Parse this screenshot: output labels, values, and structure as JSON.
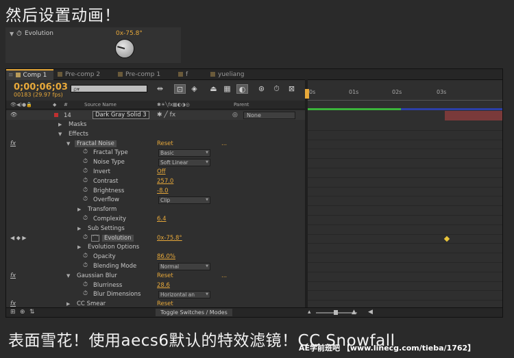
{
  "captions": {
    "top": "然后设置动画！",
    "bottom": "表面雪花！使用aecs6默认的特效滤镜！CC Snowfall",
    "watermark": "AE学前班吧 【www.linecg.com/tieba/1762】"
  },
  "evolution_preview": {
    "name": "Evolution",
    "value": "0x-75.8°"
  },
  "tabs": [
    {
      "label": "Comp 1",
      "active": true,
      "chip": "#b79a5a"
    },
    {
      "label": "Pre-comp 2",
      "active": false,
      "chip": "#6a5a3a"
    },
    {
      "label": "Pre-comp 1",
      "active": false,
      "chip": "#6a5a3a"
    },
    {
      "label": "f",
      "active": false,
      "chip": "#6a5a3a"
    },
    {
      "label": "yueliang",
      "active": false,
      "chip": "#6a5a3a"
    }
  ],
  "time": {
    "current": "0;00;06;03",
    "frames": "00183 (29.97 fps)"
  },
  "search": {
    "placeholder": "ρ▾"
  },
  "ruler": [
    "0s",
    "01s",
    "02s",
    "03s"
  ],
  "columns": {
    "num": "#",
    "source": "Source Name",
    "parent": "Parent"
  },
  "layer": {
    "index": "14",
    "name": "Dark Gray Solid 3",
    "parent": "None"
  },
  "properties": [
    {
      "indent": 1,
      "label": "Masks",
      "twirl": "▶"
    },
    {
      "indent": 1,
      "label": "Effects",
      "twirl": "▼"
    },
    {
      "indent": 2,
      "label": "Fractal Noise",
      "twirl": "▼",
      "fx": "fx",
      "reset": "Reset",
      "dots": "...",
      "highlight": true
    },
    {
      "indent": 3,
      "label": "Fractal Type",
      "stopwatch": true,
      "dropdown": "Basic"
    },
    {
      "indent": 3,
      "label": "Noise Type",
      "stopwatch": true,
      "dropdown": "Soft Linear"
    },
    {
      "indent": 3,
      "label": "Invert",
      "stopwatch": true,
      "value": "Off"
    },
    {
      "indent": 3,
      "label": "Contrast",
      "stopwatch": true,
      "value": "257.0"
    },
    {
      "indent": 3,
      "label": "Brightness",
      "stopwatch": true,
      "value": "-8.0"
    },
    {
      "indent": 3,
      "label": "Overflow",
      "stopwatch": true,
      "dropdown": "Clip"
    },
    {
      "indent": 3,
      "label": "Transform",
      "twirl": "▶"
    },
    {
      "indent": 3,
      "label": "Complexity",
      "stopwatch": true,
      "value": "6.4"
    },
    {
      "indent": 3,
      "label": "Sub Settings",
      "twirl": "▶"
    },
    {
      "indent": 3,
      "label": "Evolution",
      "stopwatch": true,
      "value": "0x-75.8°",
      "keyframed": true,
      "highlight": true
    },
    {
      "indent": 3,
      "label": "Evolution Options",
      "twirl": "▶"
    },
    {
      "indent": 3,
      "label": "Opacity",
      "stopwatch": true,
      "value": "86.0%"
    },
    {
      "indent": 3,
      "label": "Blending Mode",
      "stopwatch": true,
      "dropdown": "Normal"
    },
    {
      "indent": 2,
      "label": "Gaussian Blur",
      "twirl": "▼",
      "fx": "fx",
      "reset": "Reset",
      "dots": "..."
    },
    {
      "indent": 3,
      "label": "Blurriness",
      "stopwatch": true,
      "value": "28.6"
    },
    {
      "indent": 3,
      "label": "Blur Dimensions",
      "stopwatch": true,
      "dropdown": "Horizontal an"
    },
    {
      "indent": 2,
      "label": "CC Smear",
      "twirl": "▶",
      "fx": "fx",
      "reset": "Reset"
    }
  ],
  "bottom": {
    "toggle": "Toggle Switches / Modes"
  },
  "colors": {
    "accent": "#e8a93a",
    "work_area": "#3bb53b",
    "layer_bar": "#7a3a3a",
    "keyframe": "#e8c43a"
  }
}
